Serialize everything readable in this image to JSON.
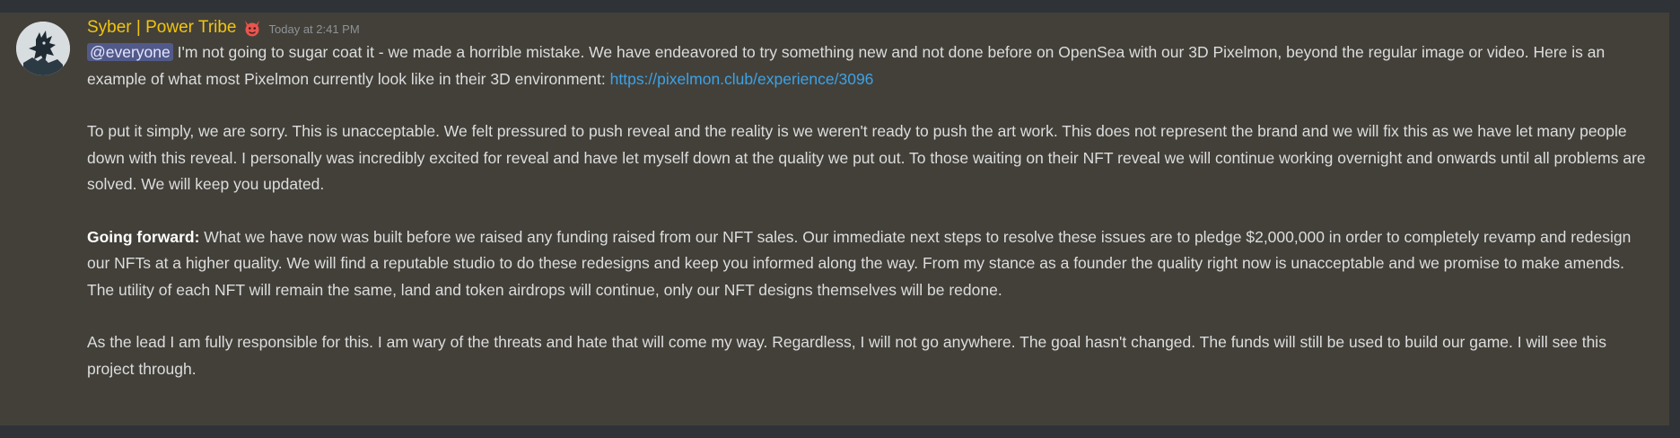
{
  "message": {
    "author": "Syber | Power Tribe",
    "timestamp": "Today at 2:41 PM",
    "icons": {
      "avatar": "dragon-avatar",
      "role_badge": "devil-emoji-badge"
    },
    "colors": {
      "author": "#f1c40f",
      "link": "#3ca2e6",
      "mention_bg": "#525a8a",
      "message_bg": "#434039",
      "frame_bg": "#2f3237"
    },
    "paragraph1": {
      "mention": "@everyone",
      "text": " I'm not going to sugar coat it - we made a horrible mistake. We have endeavored to try something new and not done before on OpenSea with our 3D Pixelmon, beyond the regular image or video. Here is an example of what most Pixelmon currently look like in their 3D environment: ",
      "link": "https://pixelmon.club/experience/3096"
    },
    "paragraph2": "To put it simply, we are sorry. This is unacceptable. We felt pressured to push reveal and the reality is we weren't ready to push the art work. This does not represent the brand and we will fix this as we have let many people down with this reveal. I personally was incredibly excited for reveal and have let myself down at the quality we put out. To those waiting on their NFT reveal we will continue working overnight and onwards until all problems are solved. We will keep you updated.",
    "paragraph3": {
      "bold": "Going forward:",
      "text": " What we have now was built before we raised any funding raised from our NFT sales. Our immediate next steps to resolve these issues are to pledge $2,000,000 in order to completely revamp and redesign our NFTs at a higher quality. We will find a reputable studio to do these redesigns and keep you informed along the way. From my stance as a founder the quality right now is unacceptable and we promise to make amends. The utility of each NFT will remain the same, land and token airdrops will continue, only our NFT designs themselves will be redone."
    },
    "paragraph4": "As the lead I am fully responsible for this. I am wary of the threats and hate that will come my way. Regardless, I will not go anywhere. The goal hasn't changed. The funds will still be used to build our game. I will see this project through."
  }
}
